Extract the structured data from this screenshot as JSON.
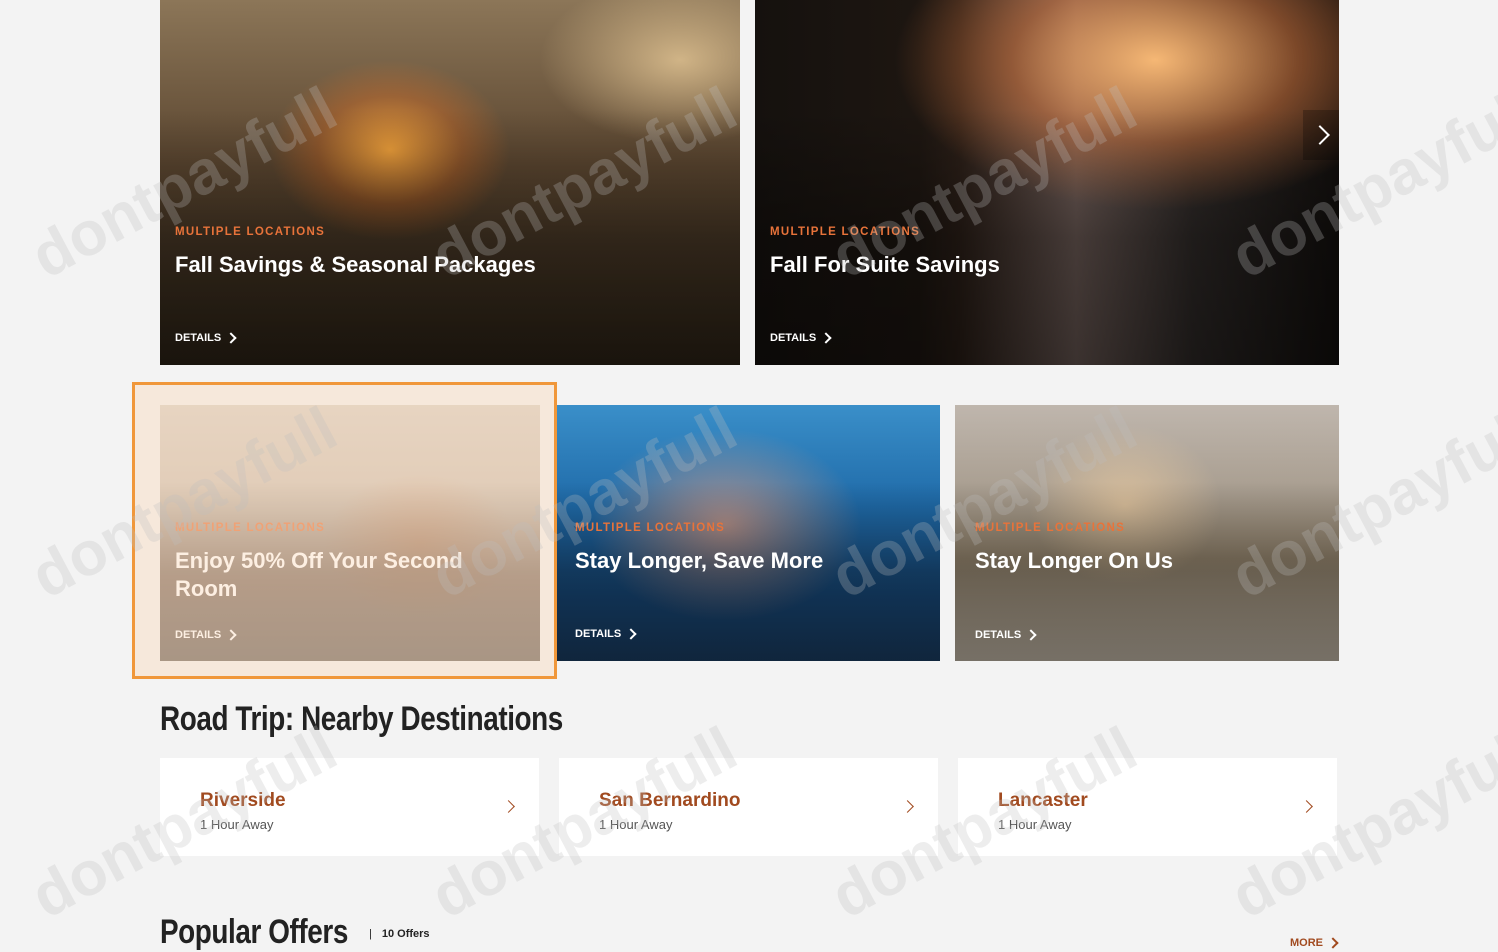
{
  "offers_grid": {
    "cards": [
      {
        "kicker": "MULTIPLE LOCATIONS",
        "title": "Fall Savings & Seasonal Packages",
        "details": "DETAILS"
      },
      {
        "kicker": "MULTIPLE LOCATIONS",
        "title": "Fall For Suite Savings",
        "details": "DETAILS"
      },
      {
        "kicker": "MULTIPLE LOCATIONS",
        "title": "Enjoy 50% Off Your Second Room",
        "details": "DETAILS"
      },
      {
        "kicker": "MULTIPLE LOCATIONS",
        "title": "Stay Longer, Save More",
        "details": "DETAILS"
      },
      {
        "kicker": "MULTIPLE LOCATIONS",
        "title": "Stay Longer On Us",
        "details": "DETAILS"
      }
    ],
    "next_arrow_icon": "chevron-right-icon"
  },
  "road_trip": {
    "title": "Road Trip: Nearby Destinations",
    "destinations": [
      {
        "name": "Riverside",
        "distance": "1 Hour Away"
      },
      {
        "name": "San Bernardino",
        "distance": "1 Hour Away"
      },
      {
        "name": "Lancaster",
        "distance": "1 Hour Away"
      }
    ]
  },
  "popular_offers": {
    "title": "Popular Offers",
    "separator": "|",
    "count": "10 Offers",
    "more_label": "MORE"
  },
  "watermark": "dontpayfull",
  "colors": {
    "accent": "#e8733a",
    "link": "#a14a1f",
    "highlight_border": "#f0973a",
    "background": "#f3f3f3"
  }
}
